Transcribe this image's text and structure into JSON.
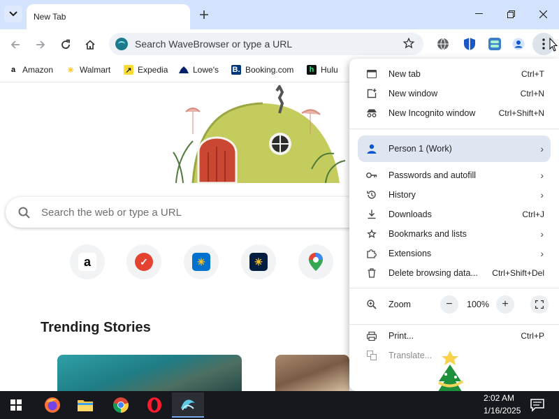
{
  "browser": {
    "tab": {
      "title": "New Tab"
    },
    "omnibox": {
      "placeholder": "Search WaveBrowser or type a URL"
    },
    "bookmarks": [
      {
        "label": "Amazon",
        "icon": "amazon-icon",
        "color": "#000000"
      },
      {
        "label": "Walmart",
        "icon": "walmart-icon",
        "color": "#ffc220"
      },
      {
        "label": "Expedia",
        "icon": "expedia-icon",
        "color": "#fddb32"
      },
      {
        "label": "Lowe's",
        "icon": "lowes-icon",
        "color": "#012169"
      },
      {
        "label": "Booking.com",
        "icon": "booking-icon",
        "color": "#003580"
      },
      {
        "label": "Hulu",
        "icon": "hulu-icon",
        "color": "#1ce783"
      }
    ]
  },
  "ntp": {
    "search_placeholder": "Search the web or type a URL",
    "shortcuts": [
      {
        "name": "amazon",
        "glyph": "a",
        "bg": "#ffffff",
        "fg": "#000000"
      },
      {
        "name": "todoist",
        "glyph": "✓",
        "bg": "#e44332",
        "fg": "#ffffff"
      },
      {
        "name": "walmart",
        "glyph": "✳",
        "bg": "#0071ce",
        "fg": "#ffc220"
      },
      {
        "name": "walmart-dark",
        "glyph": "✳",
        "bg": "#041e42",
        "fg": "#ffc220"
      },
      {
        "name": "maps",
        "glyph": "⬤",
        "bg": "#ffffff",
        "fg": "#34a853"
      }
    ],
    "trending_title": "Trending Stories"
  },
  "menu": {
    "items": [
      {
        "label": "New tab",
        "shortcut": "Ctrl+T",
        "icon": "new-tab-icon"
      },
      {
        "label": "New window",
        "shortcut": "Ctrl+N",
        "icon": "new-window-icon"
      },
      {
        "label": "New Incognito window",
        "shortcut": "Ctrl+Shift+N",
        "icon": "incognito-icon"
      },
      {
        "label": "Person 1 (Work)",
        "icon": "person-icon"
      },
      {
        "label": "Passwords and autofill",
        "icon": "key-icon"
      },
      {
        "label": "History",
        "icon": "history-icon"
      },
      {
        "label": "Downloads",
        "shortcut": "Ctrl+J",
        "icon": "download-icon"
      },
      {
        "label": "Bookmarks and lists",
        "icon": "star-icon"
      },
      {
        "label": "Extensions",
        "icon": "puzzle-icon"
      },
      {
        "label": "Delete browsing data...",
        "shortcut": "Ctrl+Shift+Del",
        "icon": "trash-icon"
      },
      {
        "label": "Zoom",
        "icon": "zoom-icon"
      },
      {
        "label": "Print...",
        "shortcut": "Ctrl+P",
        "icon": "print-icon"
      },
      {
        "label": "Translate...",
        "icon": "translate-icon"
      }
    ],
    "zoom": {
      "value": "100%",
      "minus": "−",
      "plus": "+"
    }
  },
  "taskbar": {
    "apps": [
      "start",
      "firefox",
      "file-explorer",
      "chrome",
      "opera",
      "wavebrowser"
    ],
    "time": "2:02 AM",
    "date": "1/16/2025"
  },
  "colors": {
    "tabstrip": "#d3e3fd",
    "accent": "#0b57d0",
    "taskbar": "#16181d"
  }
}
